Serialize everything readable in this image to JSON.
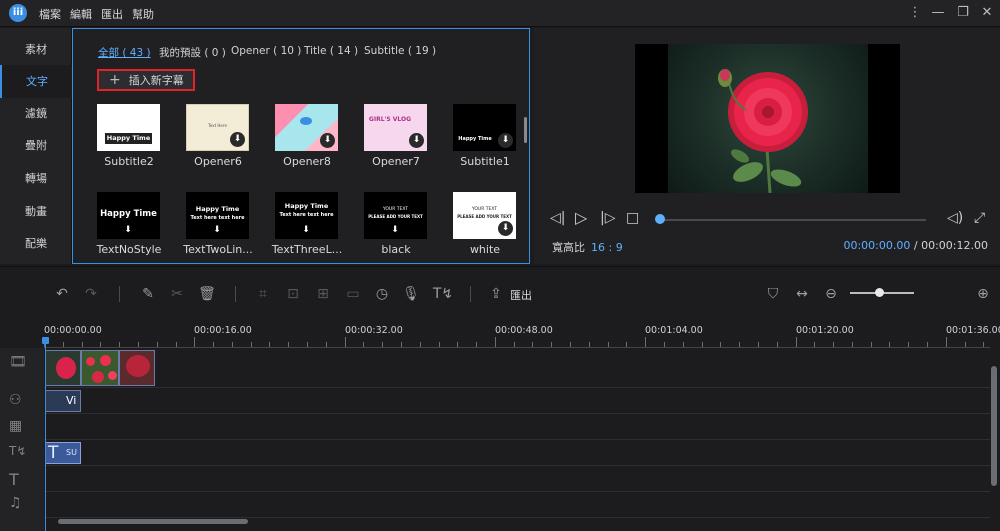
{
  "app": {
    "logo_text": "iii"
  },
  "menubar": [
    {
      "label": "檔案"
    },
    {
      "label": "編輯"
    },
    {
      "label": "匯出"
    },
    {
      "label": "幫助"
    }
  ],
  "window_controls": {
    "more": "⋮",
    "minimize": "—",
    "restore": "❐",
    "close": "✕"
  },
  "sidebar": {
    "items": [
      {
        "label": "素材"
      },
      {
        "label": "文字",
        "active": true
      },
      {
        "label": "濾鏡"
      },
      {
        "label": "疊附"
      },
      {
        "label": "轉場"
      },
      {
        "label": "動畫"
      },
      {
        "label": "配樂"
      }
    ]
  },
  "library": {
    "tabs": [
      {
        "label": "全部 ( 43 )",
        "active": true
      },
      {
        "label": "我的預設 ( 0 )"
      },
      {
        "label": "Opener ( 10 )"
      },
      {
        "label": "Title ( 14 )"
      },
      {
        "label": "Subtitle ( 19 )"
      }
    ],
    "insert_button": "插入新字幕",
    "items": [
      {
        "label": "Subtitle2",
        "thumb_text": "Happy Time",
        "download": false
      },
      {
        "label": "Opener6",
        "thumb_text": "Text Here",
        "download": true
      },
      {
        "label": "Opener8",
        "thumb_text": "",
        "download": true
      },
      {
        "label": "Opener7",
        "thumb_text": "GIRL'S VLOG",
        "download": true
      },
      {
        "label": "Subtitle1",
        "thumb_text": "Happy Time",
        "download": true
      },
      {
        "label": "TextNoStyle",
        "thumb_text": "Happy Time",
        "download": true
      },
      {
        "label": "TextTwoLin...",
        "thumb_text": "Happy Time",
        "thumb_sub": "Text here text here",
        "download": true
      },
      {
        "label": "TextThreeL...",
        "thumb_text": "Happy Time",
        "thumb_sub": "Text here text here",
        "download": true
      },
      {
        "label": "black",
        "thumb_text": "YOUR TEXT",
        "thumb_sub": "PLEASE ADD YOUR TEXT",
        "download": true
      },
      {
        "label": "white",
        "thumb_text": "YOUR TEXT",
        "thumb_sub": "PLEASE ADD YOUR TEXT",
        "download": true
      }
    ]
  },
  "preview": {
    "aspect_label": "寬高比",
    "aspect_value": "16 : 9",
    "current_time": "00:00:00.00",
    "separator": "/",
    "total_time": "00:00:12.00"
  },
  "toolbar": {
    "export_label": "匯出"
  },
  "timeline": {
    "ruler_labels": [
      "00:00:00.00",
      "00:00:16.00",
      "00:00:32.00",
      "00:00:48.00",
      "00:01:04.00",
      "00:01:20.00",
      "00:01:36.00"
    ],
    "clips": {
      "overlay_label": "Vi",
      "subtitle_label": "SU"
    }
  },
  "colors": {
    "accent": "#3a8fe3",
    "highlight_box": "#e02424",
    "flower": "#e8244a"
  }
}
